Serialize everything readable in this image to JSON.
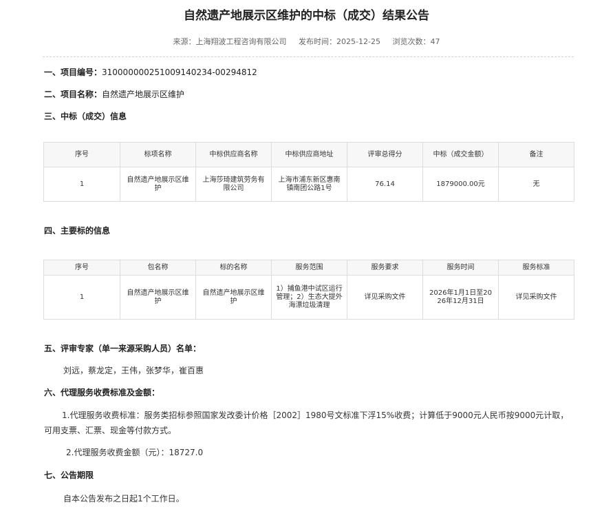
{
  "title": "自然遗产地展示区维护的中标（成交）结果公告",
  "meta": {
    "source_label": "来源：",
    "source": "上海翔波工程咨询有限公司",
    "date_label": "发布时间：",
    "date": "2025-12-25",
    "views_label": "浏览次数：",
    "views": "47"
  },
  "sections": {
    "s1_label": "一、项目编号：",
    "s1_value": "310000000251009140234-00294812",
    "s2_label": "二、项目名称：",
    "s2_value": "自然遗产地展示区维护",
    "s3_label": "三、中标（成交）信息",
    "s4_label": "四、主要标的信息",
    "s5_label": "五、评审专家（单一来源采购人员）名单：",
    "s6_label": "六、代理服务收费标准及金额：",
    "s7_label": "七、公告期限"
  },
  "award_table": {
    "headers": [
      "序号",
      "标项名称",
      "中标供应商名称",
      "中标供应商地址",
      "评审总得分",
      "中标（成交金额）",
      "备注"
    ],
    "rows": [
      [
        "1",
        "自然遗产地展示区维护",
        "上海莎琦建筑劳务有限公司",
        "上海市浦东新区惠南镇南团公路1号",
        "76.14",
        "1879000.00元",
        "无"
      ]
    ]
  },
  "subject_table": {
    "headers": [
      "序号",
      "包名称",
      "标的名称",
      "服务范围",
      "服务要求",
      "服务时间",
      "服务标准"
    ],
    "rows": [
      [
        "1",
        "自然遗产地展示区维护",
        "自然遗产地展示区维护",
        "1）捕鱼港中试区运行管理；2）生态大提外海漂垃圾清理",
        "详见采购文件",
        "2026年1月1日至2026年12月31日",
        "详见采购文件"
      ]
    ]
  },
  "experts": "刘远，蔡龙定，王伟，张梦华，崔百惠",
  "fee": {
    "standard": "1.代理服务收费标准：服务类招标参照国家发改委计价格［2002］1980号文标准下浮15%收费；计算低于9000元人民币按9000元计取，可用支票、汇票、现金等付款方式。",
    "amount": "2.代理服务收费金额（元）：18727.0"
  },
  "period": "自本公告发布之日起1个工作日。"
}
